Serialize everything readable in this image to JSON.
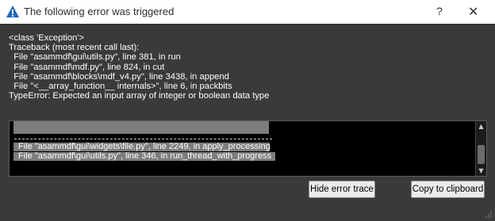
{
  "window": {
    "title": "The following error was triggered",
    "help_label": "?",
    "close_label": "✕"
  },
  "message": {
    "lines": [
      "<class 'Exception'>",
      "Traceback (most recent call last):",
      "  File \"asammdf\\gui\\utils.py\", line 381, in run",
      "  File \"asammdf\\mdf.py\", line 824, in cut",
      "  File \"asammdf\\blocks\\mdf_v4.py\", line 3438, in append",
      "  File \"<__array_function__ internals>\", line 6, in packbits",
      "TypeError: Expected an input array of integer or boolean data type"
    ]
  },
  "trace": {
    "lines": [
      " File \"asammdf\\gui\\widgets\\file.py\", line 2249, in apply_processing",
      " File \"asammdf\\gui\\utils.py\", line 346, in run_thread_with_progress"
    ]
  },
  "buttons": {
    "hide_trace": "Hide error trace",
    "copy": "Copy to clipboard"
  },
  "colors": {
    "background": "#3a3a3a",
    "trace_background": "#000000",
    "selection": "#7d7d7d"
  }
}
